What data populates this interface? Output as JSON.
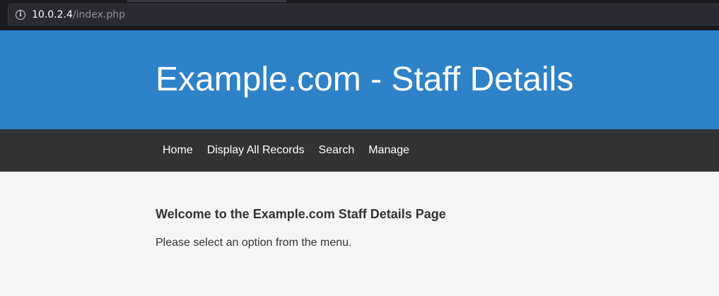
{
  "browser": {
    "url_host": "10.0.2.4",
    "url_path": "/index.php"
  },
  "header": {
    "title": "Example.com - Staff Details"
  },
  "nav": {
    "items": [
      {
        "label": "Home"
      },
      {
        "label": "Display All Records"
      },
      {
        "label": "Search"
      },
      {
        "label": "Manage"
      }
    ]
  },
  "main": {
    "heading": "Welcome to the Example.com Staff Details Page",
    "text": "Please select an option from the menu."
  },
  "colors": {
    "header_bg": "#2e82c8",
    "nav_bg": "#333333",
    "content_bg": "#f5f5f5"
  }
}
